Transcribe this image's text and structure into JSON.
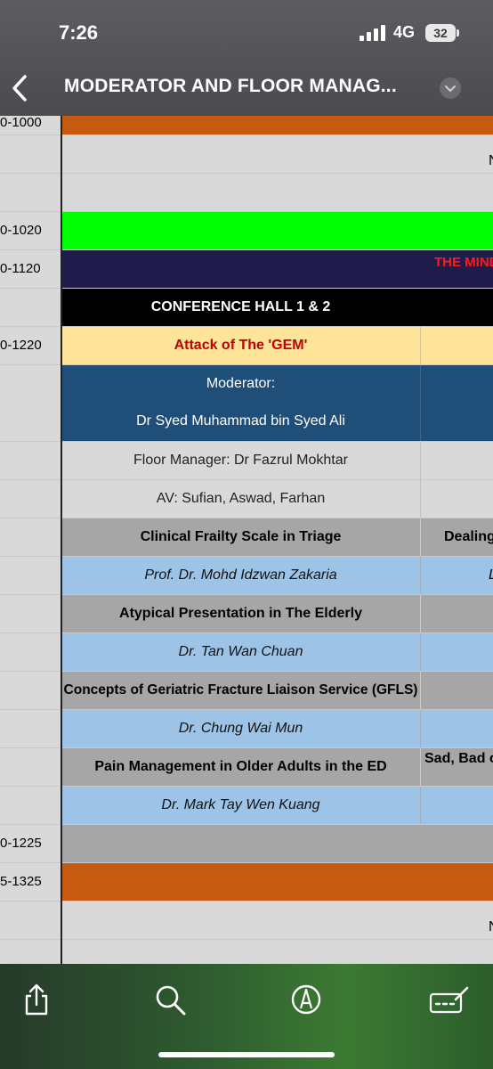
{
  "status_bar": {
    "time": "7:26",
    "network": "4G",
    "battery": "32"
  },
  "header": {
    "title": "MODERATOR AND FLOOR MANAG..."
  },
  "sheet": {
    "rows": [
      {
        "time": "0-1000",
        "main": "",
        "side": ""
      },
      {
        "time": "",
        "main": "",
        "side": "N"
      },
      {
        "time": "",
        "main": "",
        "side": ""
      },
      {
        "time": "0-1020",
        "main": "",
        "side": ""
      },
      {
        "time": "0-1120",
        "main": "",
        "side": "THE MIND"
      },
      {
        "time": "",
        "main": "CONFERENCE HALL 1 & 2",
        "side": ""
      },
      {
        "time": "0-1220",
        "main": "Attack of The 'GEM'",
        "side": ""
      },
      {
        "time": "",
        "main": "Moderator:",
        "side": ""
      },
      {
        "time": "",
        "main": "Dr Syed Muhammad bin Syed Ali",
        "side": ""
      },
      {
        "time": "",
        "main": "Floor Manager: Dr Fazrul Mokhtar",
        "side": ""
      },
      {
        "time": "",
        "main": "AV: Sufian, Aswad, Farhan",
        "side": ""
      },
      {
        "time": "",
        "main": "Clinical Frailty Scale in Triage",
        "side": "Dealing"
      },
      {
        "time": "",
        "main": "Prof. Dr. Mohd Idzwan Zakaria",
        "side": "L"
      },
      {
        "time": "",
        "main": "Atypical Presentation in The Elderly",
        "side": ""
      },
      {
        "time": "",
        "main": "Dr. Tan Wan Chuan",
        "side": ""
      },
      {
        "time": "",
        "main": "Concepts of Geriatric Fracture Liaison Service (GFLS)",
        "side": ""
      },
      {
        "time": "",
        "main": "Dr. Chung Wai Mun",
        "side": ""
      },
      {
        "time": "",
        "main": "Pain Management in Older Adults in the ED",
        "side": "Sad, Bad or"
      },
      {
        "time": "",
        "main": "Dr. Mark Tay Wen Kuang",
        "side": ""
      },
      {
        "time": "0-1225",
        "main": "",
        "side": ""
      },
      {
        "time": "5-1325",
        "main": "",
        "side": ""
      },
      {
        "time": "",
        "main": "",
        "side": "N"
      },
      {
        "time": "",
        "main": "",
        "side": ""
      }
    ]
  },
  "toolbar": {
    "share": "share-icon",
    "search": "search-icon",
    "markup": "markup-icon",
    "keyboard": "keyboard-edit-icon"
  }
}
